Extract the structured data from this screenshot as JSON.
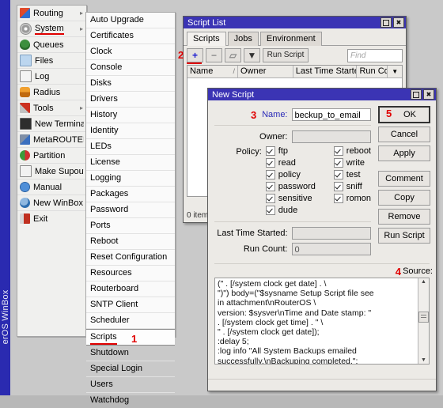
{
  "app": {
    "rail_label": "erOS WinBox"
  },
  "menu": {
    "items": [
      {
        "label": "Routing",
        "icon": "routing-icon",
        "arrow": "▸"
      },
      {
        "label": "System",
        "icon": "system-gear-icon",
        "arrow": "▸"
      },
      {
        "label": "Queues",
        "icon": "queues-icon",
        "arrow": ""
      },
      {
        "label": "Files",
        "icon": "files-icon",
        "arrow": ""
      },
      {
        "label": "Log",
        "icon": "log-icon",
        "arrow": ""
      },
      {
        "label": "Radius",
        "icon": "radius-icon",
        "arrow": ""
      },
      {
        "label": "Tools",
        "icon": "tools-icon",
        "arrow": "▸"
      },
      {
        "label": "New Terminal",
        "icon": "terminal-icon",
        "arrow": ""
      },
      {
        "label": "MetaROUTER",
        "icon": "metarouter-icon",
        "arrow": ""
      },
      {
        "label": "Partition",
        "icon": "partition-icon",
        "arrow": ""
      },
      {
        "label": "Make Supout.rif",
        "icon": "supout-icon",
        "arrow": ""
      },
      {
        "label": "Manual",
        "icon": "manual-icon",
        "arrow": ""
      },
      {
        "label": "New WinBox",
        "icon": "winbox-icon",
        "arrow": ""
      },
      {
        "label": "Exit",
        "icon": "exit-icon",
        "arrow": ""
      }
    ],
    "selected": "System"
  },
  "submenu": {
    "items": [
      "Auto Upgrade",
      "Certificates",
      "Clock",
      "Console",
      "Disks",
      "Drivers",
      "History",
      "Identity",
      "LEDs",
      "License",
      "Logging",
      "Packages",
      "Password",
      "Ports",
      "Reboot",
      "Reset Configuration",
      "Resources",
      "Routerboard",
      "SNTP Client",
      "Scheduler",
      "Scripts",
      "Shutdown",
      "Special Login",
      "Users",
      "Watchdog"
    ],
    "selected": "Scripts",
    "selected_annotation": "1"
  },
  "script_list": {
    "title": "Script List",
    "tabs": [
      "Scripts",
      "Jobs",
      "Environment"
    ],
    "active_tab": "Scripts",
    "toolbar": {
      "add_label": "+",
      "add_annotation": "2",
      "remove_label": "−",
      "copy_label": "▱",
      "filter_label": "▼",
      "run_script_label": "Run Script",
      "find_placeholder": "Find"
    },
    "columns": [
      "Name",
      "Owner",
      "Last Time Started",
      "Run Co..."
    ],
    "sort_glyph": "/",
    "dropdown_glyph": "▼",
    "rows": [],
    "status": "0 item",
    "window_buttons": {
      "restore": "□",
      "close": "✖"
    }
  },
  "new_script": {
    "title": "New Script",
    "name_label": "Name:",
    "name_annotation": "3",
    "name_value": "beckup_to_email",
    "owner_label": "Owner:",
    "owner_value": "",
    "policy_label": "Policy:",
    "policy_left": [
      {
        "label": "ftp",
        "checked": true
      },
      {
        "label": "read",
        "checked": true
      },
      {
        "label": "policy",
        "checked": true
      },
      {
        "label": "password",
        "checked": true
      },
      {
        "label": "sensitive",
        "checked": true
      },
      {
        "label": "dude",
        "checked": true
      }
    ],
    "policy_right": [
      {
        "label": "reboot",
        "checked": true
      },
      {
        "label": "write",
        "checked": true
      },
      {
        "label": "test",
        "checked": true
      },
      {
        "label": "sniff",
        "checked": true
      },
      {
        "label": "romon",
        "checked": true
      }
    ],
    "last_time_started_label": "Last Time Started:",
    "last_time_started_value": "",
    "run_count_label": "Run Count:",
    "run_count_value": "0",
    "source_label": "Source:",
    "source_annotation": "4",
    "source_value": "(\" . [/system clock get date] . \\\n\")\") body=(\"$sysname Setup Script file see\nin attachment\\nRouterOS \\\nversion: $sysver\\nTime and Date stamp: \"\n. [/system clock get time] . \" \\\n\" . [/system clock get date]);\n:delay 5;\n:log info \"All System Backups emailed\nsuccessfully.\\nBackuping completed.\";\n}",
    "buttons": [
      {
        "label": "OK",
        "primary": true,
        "annotation": "5"
      },
      {
        "label": "Cancel",
        "primary": false
      },
      {
        "label": "Apply",
        "primary": false
      },
      {
        "label": "Comment",
        "primary": false
      },
      {
        "label": "Copy",
        "primary": false
      },
      {
        "label": "Remove",
        "primary": false
      },
      {
        "label": "Run Script",
        "primary": false
      }
    ],
    "window_buttons": {
      "restore": "□",
      "close": "✖"
    }
  }
}
